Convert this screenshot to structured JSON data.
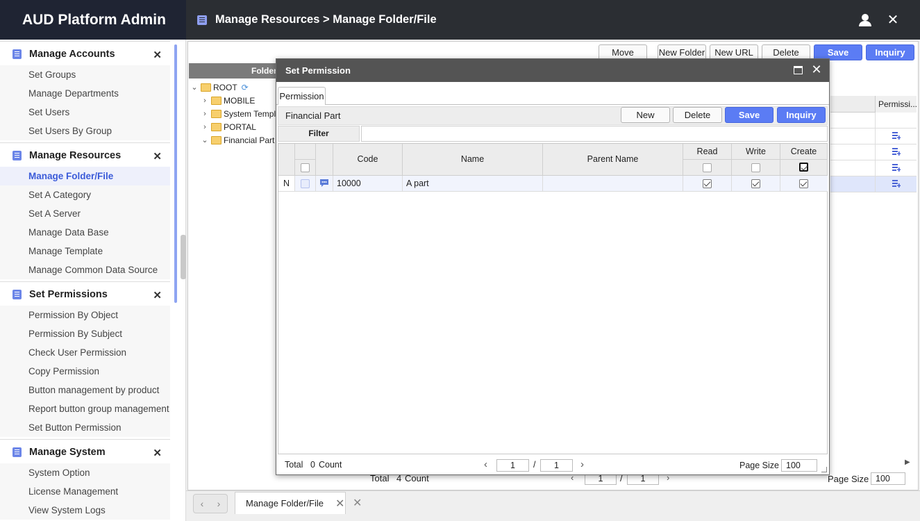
{
  "app": {
    "title": "AUD Platform Admin"
  },
  "header": {
    "breadcrumb": "Manage Resources > Manage Folder/File"
  },
  "sidebar": {
    "accounts": {
      "title": "Manage Accounts",
      "items": [
        "Set Groups",
        "Manage Departments",
        "Set Users",
        "Set Users By Group"
      ]
    },
    "resources": {
      "title": "Manage Resources",
      "items": [
        "Manage Folder/File",
        "Set A Category",
        "Set A Server",
        "Manage Data Base",
        "Manage Template",
        "Manage Common Data Source"
      ]
    },
    "permissions": {
      "title": "Set Permissions",
      "items": [
        "Permission By Object",
        "Permission By Subject",
        "Check User Permission",
        "Copy Permission",
        "Button management by product",
        "Report button group management",
        "Set Button Permission"
      ]
    },
    "system": {
      "title": "Manage System",
      "items": [
        "System Option",
        "License Management",
        "View System Logs"
      ]
    }
  },
  "toolbar": {
    "move": "Move",
    "new_folder": "New Folder",
    "new_url": "New URL",
    "delete": "Delete",
    "save": "Save",
    "inquiry": "Inquiry"
  },
  "tree": {
    "header": "Folder",
    "nodes": [
      "ROOT",
      "MOBILE",
      "System Templ",
      "PORTAL",
      "Financial Part"
    ]
  },
  "background_grid": {
    "perm_col": "Permissi...",
    "footer": {
      "total_label": "Total",
      "count": "4",
      "count_label": "Count",
      "page": "1",
      "sep": "/",
      "pages": "1",
      "page_size_label": "Page Size",
      "page_size": "100"
    }
  },
  "modal": {
    "title": "Set Permission",
    "tab": "Permission",
    "section": "Financial Part",
    "buttons": {
      "new": "New",
      "delete": "Delete",
      "save": "Save",
      "inquiry": "Inquiry"
    },
    "filter_label": "Filter",
    "columns": {
      "code": "Code",
      "name": "Name",
      "parent": "Parent Name",
      "read": "Read",
      "write": "Write",
      "create": "Create"
    },
    "rows": [
      {
        "state": "N",
        "code": "10000",
        "name": "A part",
        "parent": "",
        "read": true,
        "write": true,
        "create": true
      }
    ],
    "footer": {
      "total_label": "Total",
      "count": "0",
      "count_label": "Count",
      "page": "1",
      "sep": "/",
      "pages": "1",
      "page_size_label": "Page Size",
      "page_size": "100"
    }
  },
  "bottom": {
    "tab": "Manage Folder/File"
  }
}
